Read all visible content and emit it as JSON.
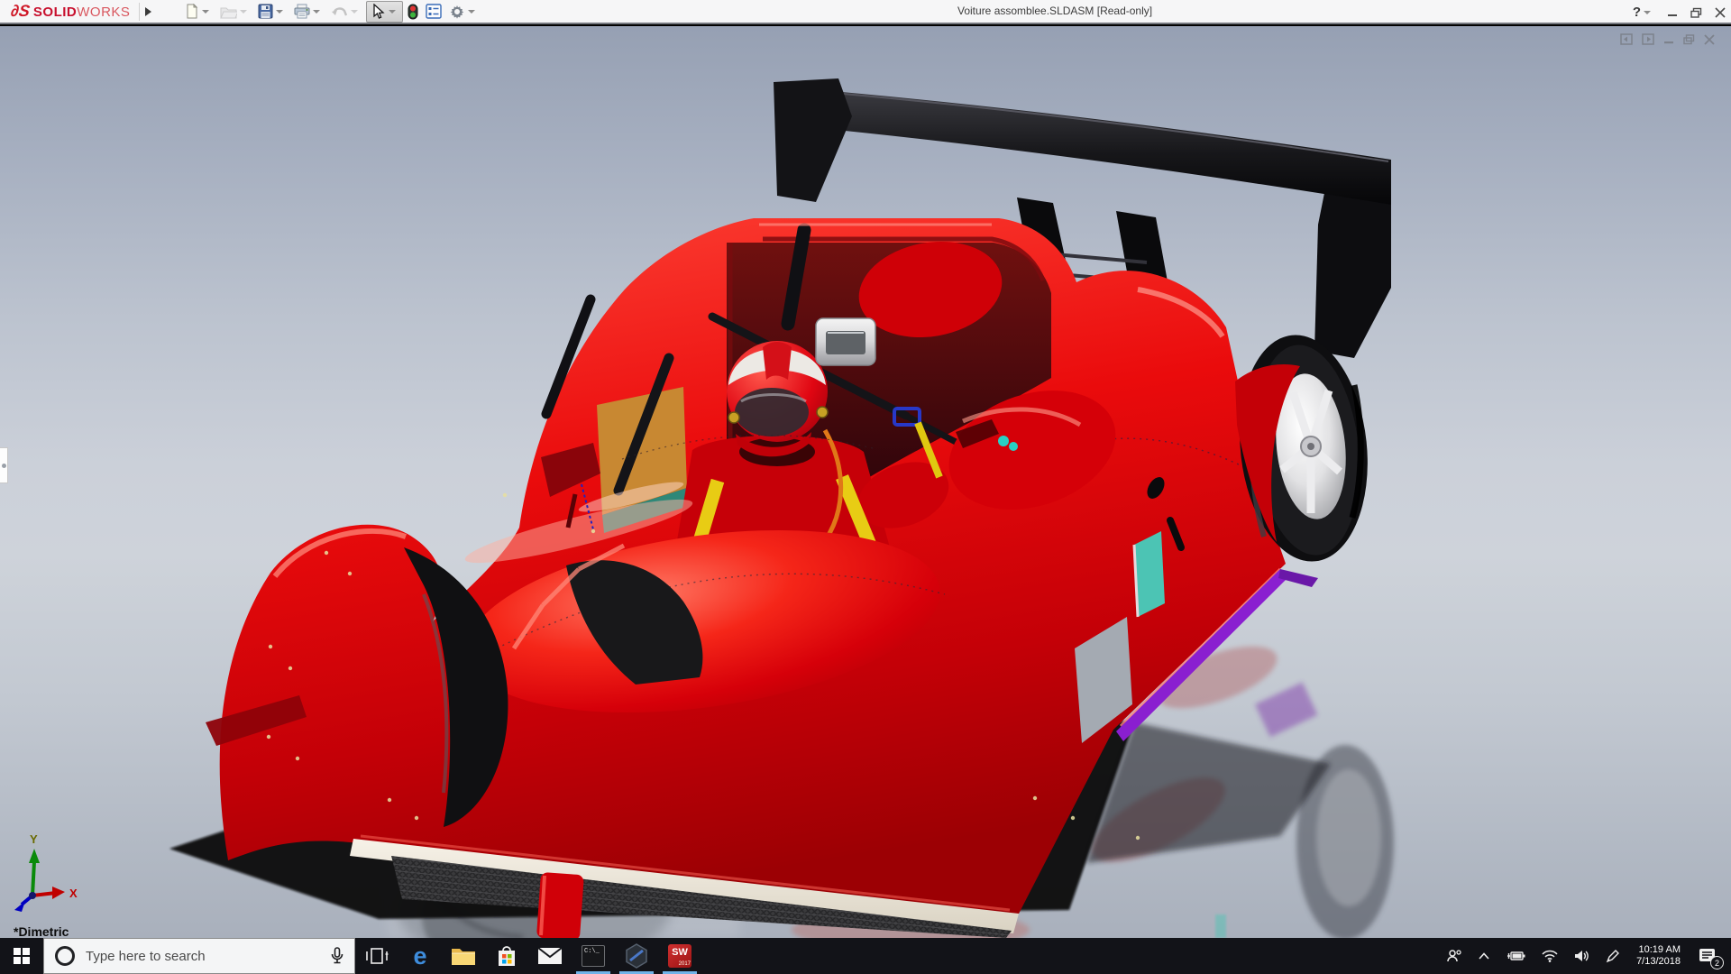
{
  "titlebar": {
    "brand": {
      "glyph": "∂S",
      "bold": "SOLID",
      "light": "WORKS"
    },
    "title": "Voiture assomblee.SLDASM [Read-only]",
    "help_glyph": "?"
  },
  "viewport": {
    "view_label": "*Dimetric",
    "triad": {
      "x": "X",
      "y": "Y"
    }
  },
  "taskbar": {
    "search": {
      "placeholder": "Type here to search"
    },
    "icons": {
      "edge_glyph": "e",
      "cmd_text": "C:\\",
      "solidworks_text": "SW",
      "solidworks_year": "2017"
    },
    "tray": {
      "time": "10:19 AM",
      "date": "7/13/2018",
      "badge": "2"
    }
  },
  "colors": {
    "car_red": "#e10600",
    "wing_black": "#131316",
    "accent_blue": "#6fb3e8",
    "teal": "#4cc4b4",
    "purple": "#8a1fd0"
  }
}
